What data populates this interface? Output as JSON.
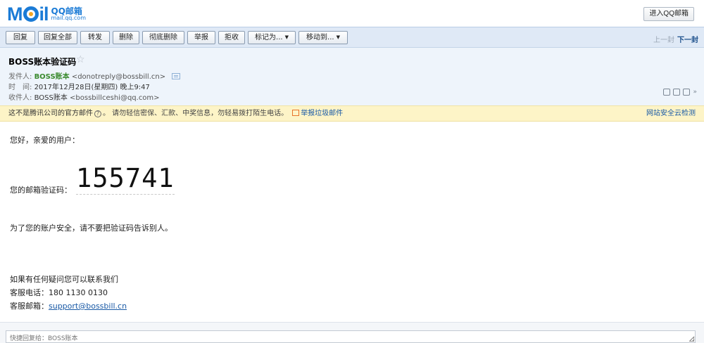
{
  "topbar": {
    "logo_word_a": "M",
    "logo_word_b": "il",
    "logo_sub_1": "QQ邮箱",
    "logo_sub_2": "mail.qq.com",
    "enter_label": "进入QQ邮箱"
  },
  "toolbar": {
    "reply": "回复",
    "reply_all": "回复全部",
    "forward": "转发",
    "delete": "删除",
    "delete_perm": "彻底删除",
    "report": "举报",
    "reject": "拒收",
    "mark_as": "标记为...",
    "move_to": "移动到...",
    "prev": "上一封",
    "next": "下一封"
  },
  "header": {
    "subject": "BOSS账本验证码",
    "from_label": "发件人:",
    "from_name": "BOSS账本",
    "from_addr": "<donotreply@bossbill.cn>",
    "time_label": "时　间:",
    "time_value": "2017年12月28日(星期四) 晚上9:47",
    "to_label": "收件人:",
    "to_name": "BOSS账本",
    "to_addr": "<bossbillceshi@qq.com>",
    "more": "»"
  },
  "warning": {
    "official_text": "这不是腾讯公司的官方邮件",
    "question_mark": "?",
    "caution_text": "。 请勿轻信密保、汇款、中奖信息，勿轻易拨打陌生电话。",
    "report_spam": "举报垃圾邮件",
    "safety_check": "网站安全云检测"
  },
  "body": {
    "greeting": "您好，亲爱的用户：",
    "code_label": "您的邮箱验证码：",
    "code": "155741",
    "security_note": "为了您的账户安全，请不要把验证码告诉别人。",
    "contact_intro": "如果有任何疑问您可以联系我们",
    "phone_label": "客服电话：",
    "phone": "180 1130 0130",
    "email_label": "客服邮箱：",
    "email": "support@bossbill.cn"
  },
  "quick_reply": {
    "placeholder": "快捷回复给：BOSS账本"
  },
  "colors": {
    "brand": "#1b7bd6",
    "sender_green": "#3a8a2e",
    "link_blue": "#1a5aa6",
    "warning_bg": "#fdf4c7"
  }
}
